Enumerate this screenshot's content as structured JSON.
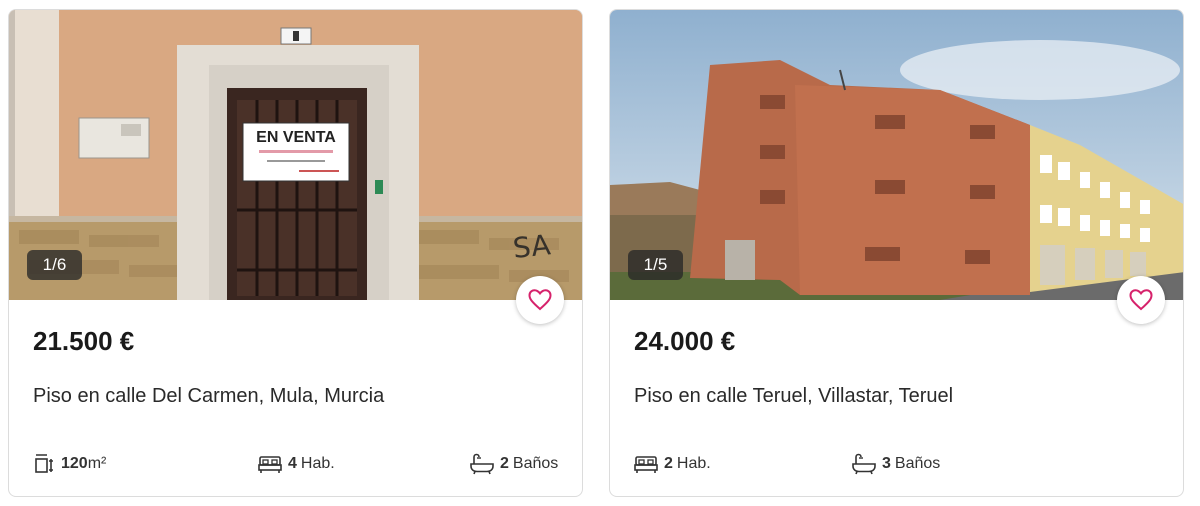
{
  "listings": [
    {
      "photo_counter": "1/6",
      "price": "21.500 €",
      "title": "Piso en calle Del Carmen, Mula, Murcia",
      "sign_text": "EN VENTA",
      "features": {
        "area_value": "120",
        "area_unit": "m²",
        "rooms_value": "4",
        "rooms_unit": "Hab.",
        "baths_value": "2",
        "baths_unit": "Baños"
      }
    },
    {
      "photo_counter": "1/5",
      "price": "24.000 €",
      "title": "Piso en calle Teruel, Villastar, Teruel",
      "features": {
        "rooms_value": "2",
        "rooms_unit": "Hab.",
        "baths_value": "3",
        "baths_unit": "Baños"
      }
    }
  ],
  "icons": {
    "favorite": "heart-outline-icon",
    "area": "area-ruler-icon",
    "rooms": "bed-icon",
    "baths": "bathtub-icon"
  },
  "colors": {
    "accent": "#d6226b"
  }
}
